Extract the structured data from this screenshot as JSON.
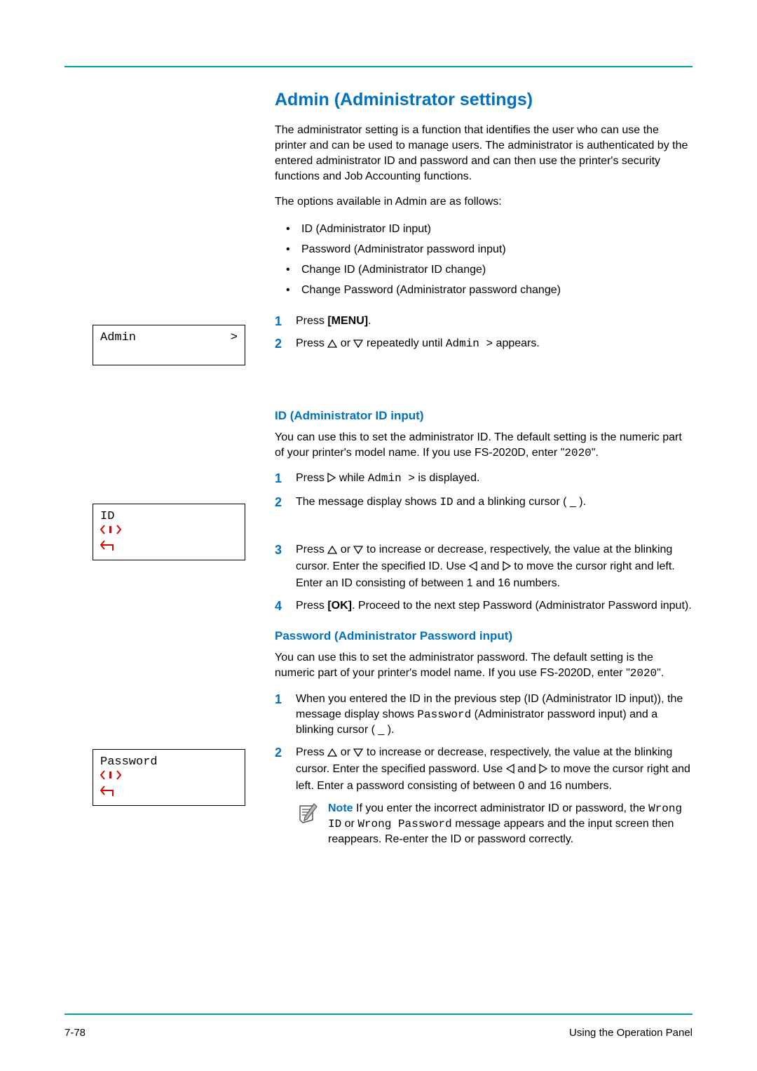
{
  "section_title": "Admin (Administrator settings)",
  "intro_p1": "The administrator setting is a function that identifies the user who can use the printer and can be used to manage users. The administrator is authenticated by the entered administrator ID and password and can then use the printer's security functions and Job Accounting functions.",
  "intro_p2": "The options available in Admin are as follows:",
  "bullets": {
    "b1": "ID (Administrator ID input)",
    "b2": "Password (Administrator password input)",
    "b3": "Change ID (Administrator ID change)",
    "b4": "Change Password (Administrator password change)"
  },
  "steps_a": {
    "s1a": "Press ",
    "s1b": "[MENU]",
    "s1c": ".",
    "s2a": "Press ",
    "s2b": " or ",
    "s2c": " repeatedly until ",
    "s2d": "Admin >",
    "s2e": " appears."
  },
  "lcd1": {
    "text": "Admin",
    "gt": ">"
  },
  "sub_id_title": "ID (Administrator ID input)",
  "id_intro_a": "You can use this to set the administrator ID. The default setting is the numeric part of your printer's model name. If you use FS-2020D, enter \"",
  "id_intro_mono": "2020",
  "id_intro_b": "\".",
  "id_steps": {
    "s1a": "Press ",
    "s1b": " while ",
    "s1c": "Admin >",
    "s1d": " is displayed.",
    "s2a": "The message display shows ",
    "s2b": "ID",
    "s2c": " and a blinking cursor ( _ ).",
    "s3a": "Press ",
    "s3b": " or ",
    "s3c": " to increase or decrease, respectively, the value at the blinking cursor. Enter the specified ID. Use ",
    "s3d": " and ",
    "s3e": " to move the cursor right and left. Enter an ID consisting of between 1 and 16 numbers.",
    "s4a": "Press ",
    "s4b": "[OK]",
    "s4c": ". Proceed to the next step Password (Administrator Password input)."
  },
  "lcd2": {
    "text": "ID"
  },
  "sub_pw_title": "Password (Administrator Password input)",
  "pw_intro_a": "You can use this to set the administrator password. The default setting is the numeric part of your printer's model name. If you use FS-2020D, enter \"",
  "pw_intro_mono": "2020",
  "pw_intro_b": "\".",
  "pw_steps": {
    "s1a": "When you entered the ID in the previous step (ID (Administrator ID input)), the message display shows ",
    "s1b": "Password",
    "s1c": " (Administrator password input) and a blinking cursor ( _ ).",
    "s2a": "Press ",
    "s2b": " or ",
    "s2c": " to increase or decrease, respectively, the value at the blinking cursor. Enter the specified password. Use ",
    "s2d": " and ",
    "s2e": " to move the cursor right and left. Enter a password consisting of between 0 and 16 numbers."
  },
  "lcd3": {
    "text": "Password"
  },
  "note": {
    "label": "Note",
    "a": "  If you enter the incorrect administrator ID or password, the ",
    "mono1": "Wrong ID",
    "b": " or ",
    "mono2": "Wrong Password",
    "c": " message appears and the input screen then reappears. Re-enter the ID or password correctly."
  },
  "footer": {
    "page": "7-78",
    "chapter": "Using the Operation Panel"
  }
}
